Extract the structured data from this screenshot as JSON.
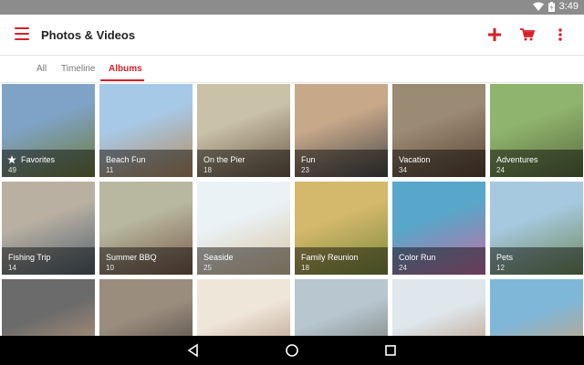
{
  "status": {
    "time": "3:49"
  },
  "app": {
    "title": "Photos & Videos"
  },
  "tabs": [
    {
      "label": "All"
    },
    {
      "label": "Timeline"
    },
    {
      "label": "Albums"
    }
  ],
  "albums": [
    {
      "name": "Favorites",
      "count": "49",
      "c1": "#7fa3c6",
      "c2": "#6f7b3c"
    },
    {
      "name": "Beach Fun",
      "count": "11",
      "c1": "#a7c9e8",
      "c2": "#b58d61"
    },
    {
      "name": "On the Pier",
      "count": "18",
      "c1": "#c9c1a8",
      "c2": "#6e5b48"
    },
    {
      "name": "Fun",
      "count": "23",
      "c1": "#c7a889",
      "c2": "#4a4a4a"
    },
    {
      "name": "Vacation",
      "count": "34",
      "c1": "#9b8a74",
      "c2": "#5c4634"
    },
    {
      "name": "Adventures",
      "count": "24",
      "c1": "#8fb46d",
      "c2": "#5b6b3f"
    },
    {
      "name": "Fishing Trip",
      "count": "14",
      "c1": "#b9b0a2",
      "c2": "#53636f"
    },
    {
      "name": "Summer BBQ",
      "count": "10",
      "c1": "#b8b8a0",
      "c2": "#7a5c4a"
    },
    {
      "name": "Seaside",
      "count": "25",
      "c1": "#eaf2f6",
      "c2": "#d9c3a2"
    },
    {
      "name": "Family Reunion",
      "count": "18",
      "c1": "#d4b86b",
      "c2": "#7c8b3d"
    },
    {
      "name": "Color Run",
      "count": "24",
      "c1": "#58a6c9",
      "c2": "#c36fa2"
    },
    {
      "name": "Pets",
      "count": "12",
      "c1": "#a6c9df",
      "c2": "#6f8a5b"
    },
    {
      "name": "",
      "count": "",
      "c1": "#6b6b6b",
      "c2": "#c9a07e"
    },
    {
      "name": "",
      "count": "",
      "c1": "#9b8d7e",
      "c2": "#3f3a36"
    },
    {
      "name": "",
      "count": "",
      "c1": "#efe6da",
      "c2": "#a78a72"
    },
    {
      "name": "",
      "count": "",
      "c1": "#b7c6cf",
      "c2": "#6b6f65"
    },
    {
      "name": "",
      "count": "",
      "c1": "#dfe7ec",
      "c2": "#b28b6e"
    },
    {
      "name": "",
      "count": "",
      "c1": "#7fb7d9",
      "c2": "#d9a067"
    }
  ],
  "colors": {
    "accent": "#d51f2a"
  }
}
